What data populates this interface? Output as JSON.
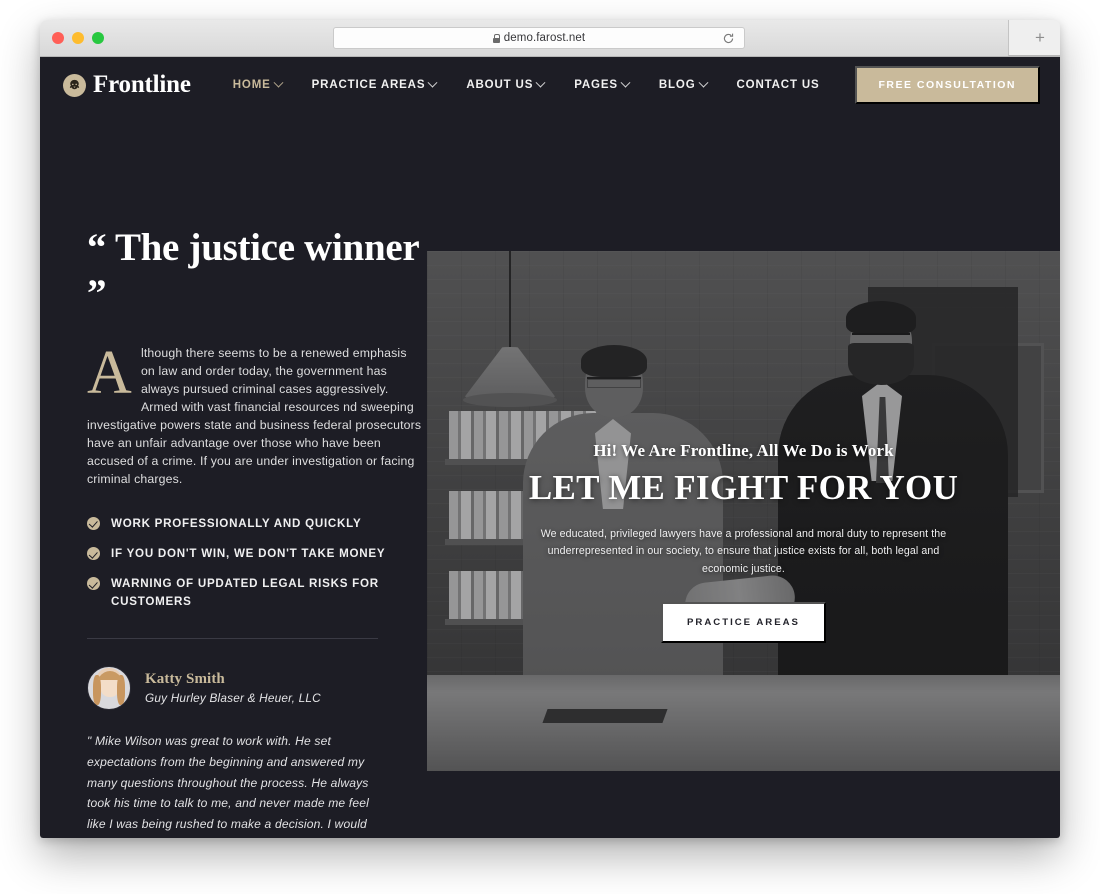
{
  "browser": {
    "url": "demo.farost.net",
    "lock_icon": "lock-icon",
    "reload_icon": "reload-icon",
    "newtab_label": "+",
    "traffic_lights": [
      "close",
      "minimize",
      "maximize"
    ]
  },
  "header": {
    "logo_text": "Frontline",
    "logo_icon": "lion-crest-icon",
    "nav": [
      {
        "label": "HOME",
        "has_caret": true,
        "active": true
      },
      {
        "label": "PRACTICE AREAS",
        "has_caret": true,
        "active": false
      },
      {
        "label": "ABOUT US",
        "has_caret": true,
        "active": false
      },
      {
        "label": "PAGES",
        "has_caret": true,
        "active": false
      },
      {
        "label": "BLOG",
        "has_caret": true,
        "active": false
      },
      {
        "label": "CONTACT US",
        "has_caret": false,
        "active": false
      }
    ],
    "cta_label": "FREE CONSULTATION"
  },
  "left": {
    "title": "“ The justice winner ”",
    "dropcap": "A",
    "lead": "lthough there seems to be a renewed emphasis on law and order today, the government has always pursued criminal cases aggressively. Armed with vast financial resources nd sweeping investigative powers state and business federal prosecutors have an unfair advantage over those who have been accused of a crime. If you are under investigation or facing criminal charges.",
    "features": [
      "WORK PROFESSIONALLY AND QUICKLY",
      "IF YOU DON'T WIN, WE DON'T TAKE MONEY",
      "WARNING OF UPDATED LEGAL RISKS FOR CUSTOMERS"
    ],
    "testimonial": {
      "name": "Katty Smith",
      "firm": "Guy Hurley Blaser & Heuer, LLC",
      "quote": "\" Mike Wilson was great to work with. He set expectations from the beginning and answered my many questions throughout the process. He always took his time to talk to me, and never made me feel like I was being rushed to make a decision. I would absolutely do business with Mike again in the future. \""
    }
  },
  "hero": {
    "kicker": "Hi! We Are Frontline, All We Do is Work",
    "headline": "LET ME FIGHT FOR YOU",
    "subtext": "We educated, privileged lawyers have a professional and moral duty to represent the underrepresented in our society, to ensure that justice exists for all, both legal and economic justice.",
    "button_label": "PRACTICE AREAS"
  },
  "colors": {
    "page_bg": "#1d1d25",
    "accent_tan": "#c9ba9b",
    "text_white": "#ffffff",
    "browser_chrome": "#e0e0e0"
  }
}
